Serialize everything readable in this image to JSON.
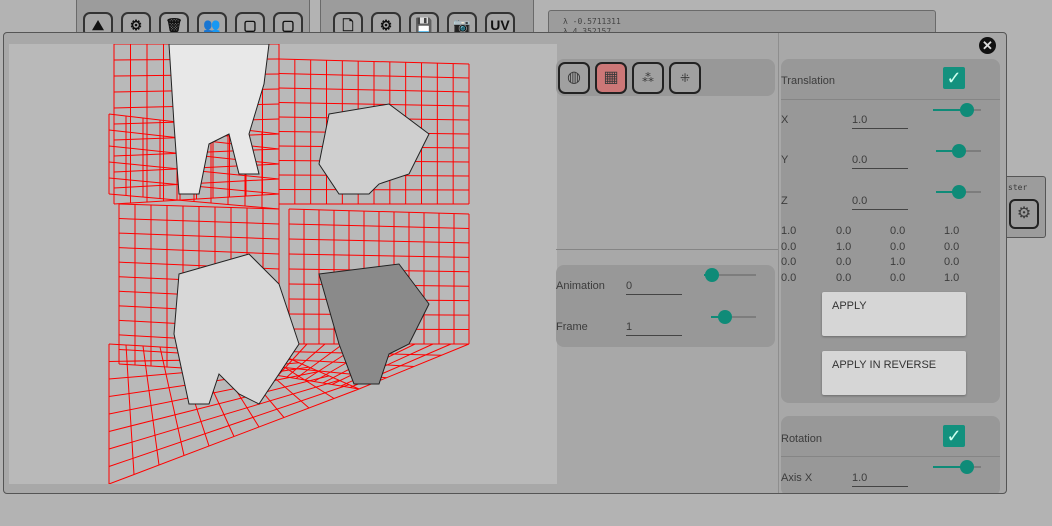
{
  "background_toolbars": {
    "left_icons": [
      "scene-icon",
      "settings-icon",
      "delete-icon",
      "group-icon",
      "frame-icon",
      "frame-alt-icon"
    ],
    "middle_icons": [
      "file-icon",
      "settings-icon",
      "save-icon",
      "camera-icon",
      "uv-icon"
    ],
    "middle_uv_label": "UV",
    "right_readout": [
      "λ -0.5711311",
      "λ 4.352157"
    ],
    "side_label": "ster"
  },
  "modal": {
    "close_icon": "close-circle-icon",
    "view_tools": [
      "texture-sphere-icon",
      "grid-icon",
      "multi-instance-icon",
      "bounds-icon"
    ],
    "animation": {
      "label": "Animation",
      "value": "0",
      "slider": 0.15
    },
    "frame": {
      "label": "Frame",
      "value": "1",
      "slider": 0.3
    },
    "translation": {
      "title": "Translation",
      "enabled": true,
      "x": {
        "label": "X",
        "value": "1.0",
        "slider": 0.7
      },
      "y": {
        "label": "Y",
        "value": "0.0",
        "slider": 0.5
      },
      "z": {
        "label": "Z",
        "value": "0.0",
        "slider": 0.52
      },
      "matrix": [
        [
          "1.0",
          "0.0",
          "0.0",
          "1.0"
        ],
        [
          "0.0",
          "1.0",
          "0.0",
          "0.0"
        ],
        [
          "0.0",
          "0.0",
          "1.0",
          "0.0"
        ],
        [
          "0.0",
          "0.0",
          "0.0",
          "1.0"
        ]
      ],
      "apply_label": "APPLY",
      "apply_reverse_label": "APPLY IN REVERSE"
    },
    "rotation": {
      "title": "Rotation",
      "enabled": true,
      "axis_label": "Axis X",
      "axis_value": "1.0",
      "slider": 0.7
    }
  },
  "colors": {
    "accent": "#13917e",
    "grid": "#ff0000"
  }
}
